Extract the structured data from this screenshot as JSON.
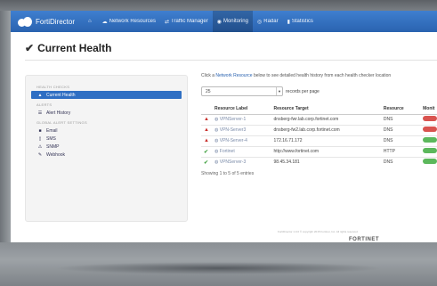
{
  "navbar": {
    "brand": "FortiDirector",
    "items": [
      {
        "icon": "home-icon",
        "glyph": "⌂",
        "label": ""
      },
      {
        "icon": "cloud-icon",
        "glyph": "☁",
        "label": "Network Resources"
      },
      {
        "icon": "traffic-icon",
        "glyph": "⇄",
        "label": "Traffic Manager"
      },
      {
        "icon": "monitoring-icon",
        "glyph": "◉",
        "label": "Monitoring"
      },
      {
        "icon": "radar-icon",
        "glyph": "◎",
        "label": "Radar"
      },
      {
        "icon": "stats-icon",
        "glyph": "▮",
        "label": "Statistics"
      }
    ]
  },
  "page": {
    "title": "Current Health"
  },
  "sidebar": {
    "sections": [
      {
        "header": "HEALTH CHECKS",
        "items": [
          {
            "label": "Current Health",
            "icon": "heart-icon",
            "glyph": "▲",
            "active": true
          }
        ]
      },
      {
        "header": "ALERTS",
        "items": [
          {
            "label": "Alert History",
            "icon": "list-icon",
            "glyph": "☰",
            "active": false
          }
        ]
      },
      {
        "header": "GLOBAL ALERT SETTINGS",
        "items": [
          {
            "label": "Email",
            "icon": "email-icon",
            "glyph": "■",
            "active": false
          },
          {
            "label": "SMS",
            "icon": "sms-icon",
            "glyph": "▯",
            "active": false
          },
          {
            "label": "SNMP",
            "icon": "snmp-icon",
            "glyph": "⚠",
            "active": false
          },
          {
            "label": "Webhook",
            "icon": "webhook-icon",
            "glyph": "✎",
            "active": false
          }
        ]
      }
    ]
  },
  "main": {
    "intro_prefix": "Click a",
    "intro_link": "Network Resource",
    "intro_suffix": "below to see detailed health history from each health checker location",
    "page_size": "25",
    "per_page_label": "records per page",
    "columns": [
      "",
      "Resource Label",
      "Resource Target",
      "Resource",
      "Monit"
    ],
    "rows": [
      {
        "status": "warn",
        "label": "VPNServer-1",
        "target": "dnsberg-fwr.lab.corp.fortinet.com",
        "type": "DNS",
        "monitor": "red"
      },
      {
        "status": "warn",
        "label": "VPN-Server3",
        "target": "dnsberg-fw2.lab.corp.fortinet.com",
        "type": "DNS",
        "monitor": "red"
      },
      {
        "status": "warn",
        "label": "VPN-Server-4",
        "target": "172.16.71.172",
        "type": "DNS",
        "monitor": "green"
      },
      {
        "status": "ok",
        "label": "Fortinet",
        "target": "http://www.fortinet.com",
        "type": "HTTP",
        "monitor": "green"
      },
      {
        "status": "ok",
        "label": "VPNServer-3",
        "target": "98.45.34.181",
        "type": "DNS",
        "monitor": "green"
      }
    ],
    "showing": "Showing 1 to 5 of 5 entries"
  },
  "footer": {
    "text": "FortiDirector 1.0.0 © copyright 2015 Fortinet, Inc. All rights reserved",
    "logo": "FORTINET"
  },
  "colors": {
    "nav": "#2a63b0",
    "active": "#2f6fc3",
    "warn": "#c9302c",
    "ok": "#47a447"
  }
}
